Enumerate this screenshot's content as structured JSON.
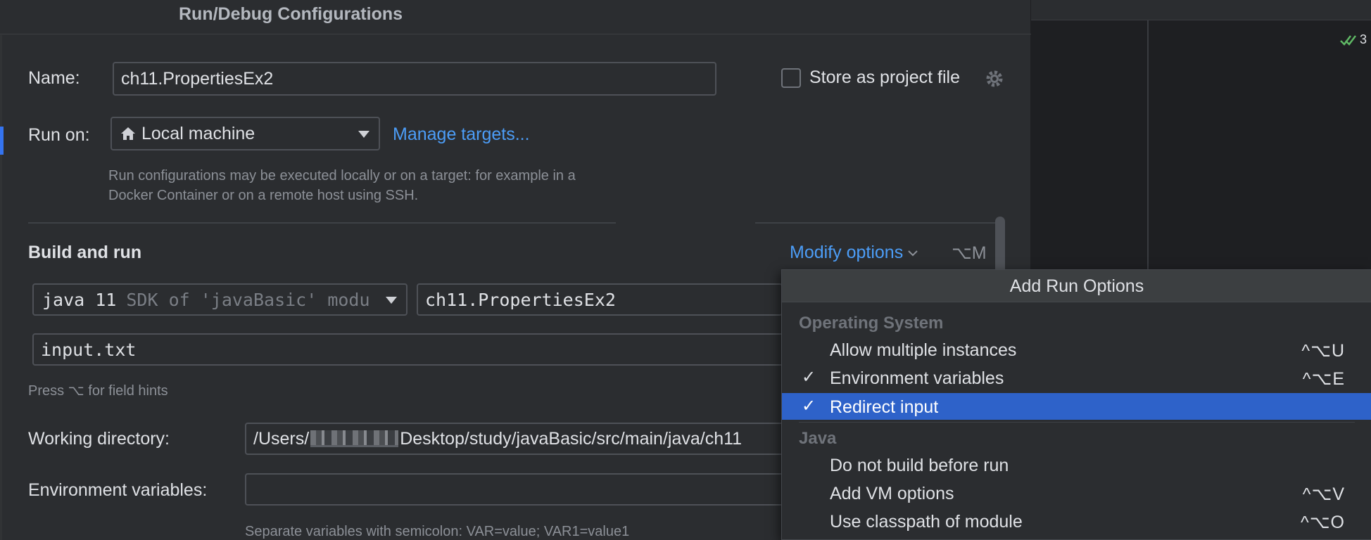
{
  "dialog": {
    "title": "Run/Debug Configurations"
  },
  "form": {
    "name_label": "Name:",
    "name_value": "ch11.PropertiesEx2",
    "store_label": "Store as project file",
    "runon_label": "Run on:",
    "runon_value": "Local machine",
    "manage_targets": "Manage targets...",
    "runon_hint": "Run configurations may be executed locally or on a target: for example in a Docker Container or on a remote host using SSH."
  },
  "build": {
    "title": "Build and run",
    "modify_options": "Modify options",
    "modify_shortcut": "⌥M",
    "sdk_value": "java 11",
    "sdk_hint": "SDK of 'javaBasic' modu",
    "main_class": "ch11.PropertiesEx2",
    "program_args": "input.txt",
    "field_hints": "Press ⌥ for field hints",
    "working_dir_label": "Working directory:",
    "working_dir_prefix": "/Users/",
    "working_dir_suffix": "Desktop/study/javaBasic/src/main/java/ch11",
    "env_label": "Environment variables:",
    "env_value": "",
    "env_hint": "Separate variables with semicolon: VAR=value; VAR1=value1"
  },
  "popup": {
    "title": "Add Run Options",
    "groups": [
      "Operating System",
      "Java"
    ],
    "options": [
      {
        "label": "Allow multiple instances",
        "shortcut": "^⌥U",
        "checked": ""
      },
      {
        "label": "Environment variables",
        "shortcut": "^⌥E",
        "checked": "✓"
      },
      {
        "label": "Redirect input",
        "shortcut": "",
        "checked": "✓"
      },
      {
        "label": "Do not build before run",
        "shortcut": "",
        "checked": ""
      },
      {
        "label": "Add VM options",
        "shortcut": "^⌥V",
        "checked": ""
      },
      {
        "label": "Use classpath of module",
        "shortcut": "^⌥O",
        "checked": ""
      }
    ]
  },
  "editor": {
    "inspection_count": "3"
  },
  "colors": {
    "accent": "#4c9df7",
    "selection": "#2e62c9",
    "background": "#2b2d30"
  }
}
